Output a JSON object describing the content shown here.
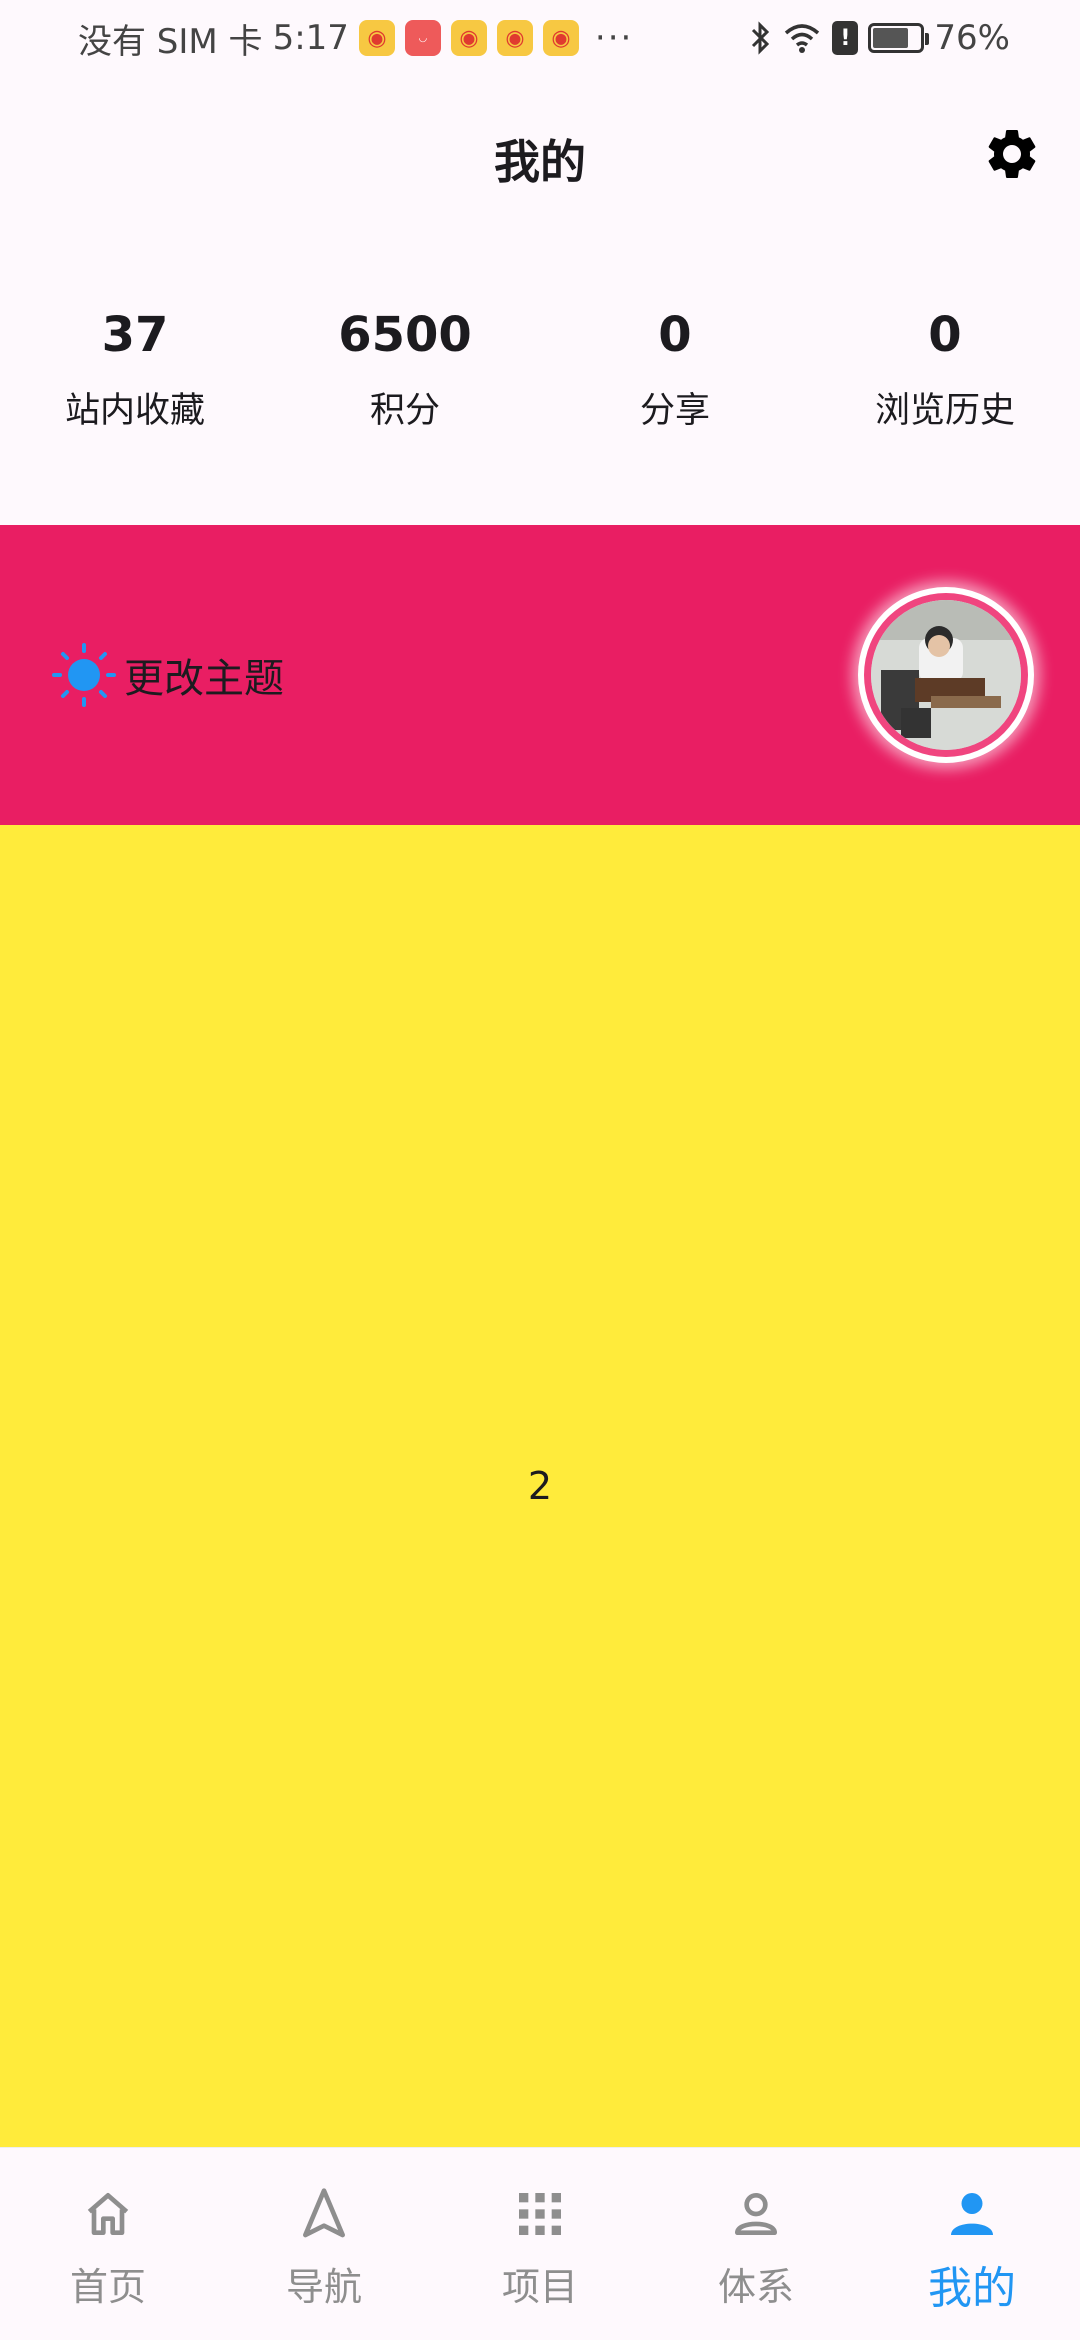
{
  "status_bar": {
    "carrier": "没有 SIM 卡",
    "time": "5:17",
    "more": "···",
    "battery": "76%",
    "battery_level": 0.76,
    "notification_icons": [
      "weibo-icon",
      "huawei-store-icon",
      "weibo-icon",
      "weibo-icon",
      "weibo-icon"
    ]
  },
  "app_bar": {
    "title": "我的",
    "settings_icon": "gear-icon"
  },
  "stats": [
    {
      "value": "37",
      "label": "站内收藏"
    },
    {
      "value": "6500",
      "label": "积分"
    },
    {
      "value": "0",
      "label": "分享"
    },
    {
      "value": "0",
      "label": "浏览历史"
    }
  ],
  "theme_banner": {
    "label": "更改主题",
    "icon": "sun-icon",
    "background": "#E91E63",
    "icon_color": "#2196F3"
  },
  "content": {
    "text": "2",
    "background": "#FFEB3B"
  },
  "bottom_nav": {
    "active_color": "#2196F3",
    "inactive_color": "#8E8E8E",
    "items": [
      {
        "label": "首页",
        "icon": "home-icon"
      },
      {
        "label": "导航",
        "icon": "navigation-icon"
      },
      {
        "label": "项目",
        "icon": "grid-icon"
      },
      {
        "label": "体系",
        "icon": "person-outline-icon"
      },
      {
        "label": "我的",
        "icon": "person-icon"
      }
    ]
  }
}
